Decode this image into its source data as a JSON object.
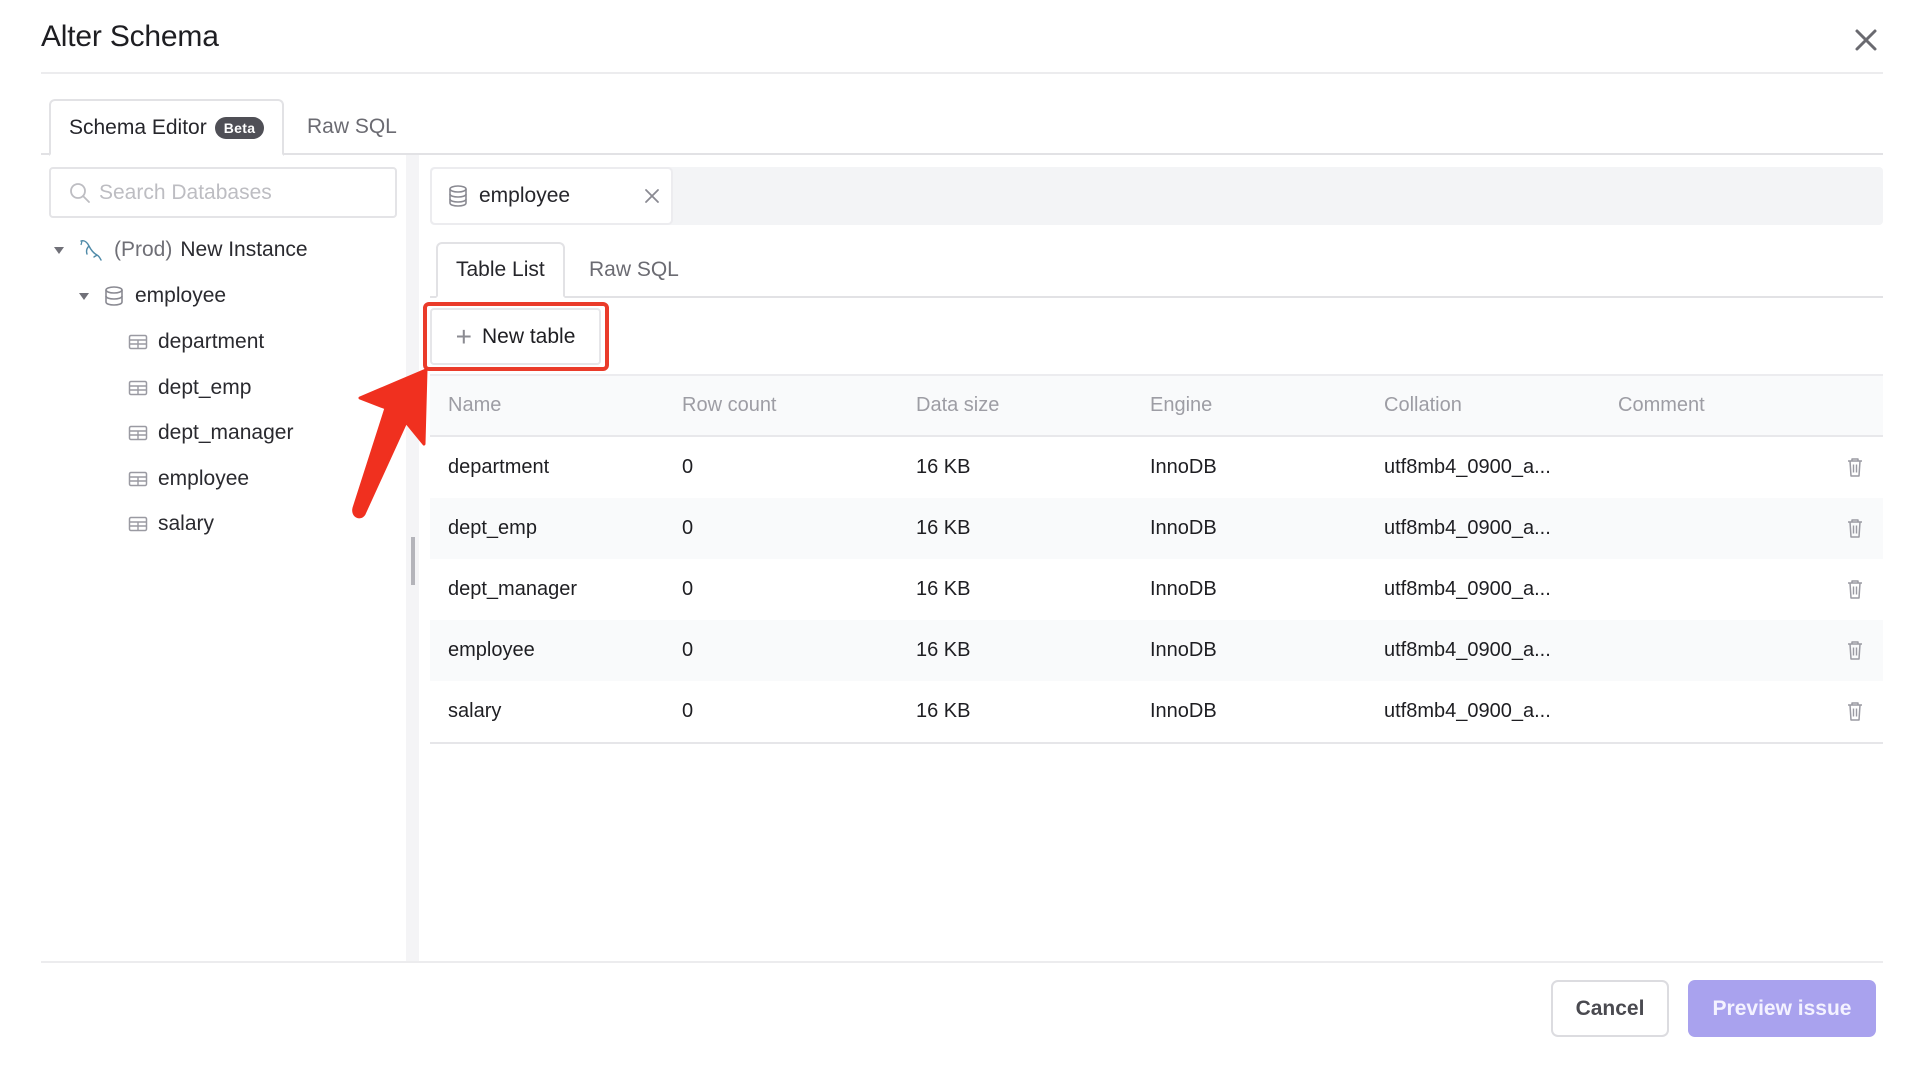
{
  "dialog": {
    "title": "Alter Schema",
    "close_icon": "close-icon"
  },
  "top_tabs": [
    {
      "label": "Schema Editor",
      "badge": "Beta",
      "active": true
    },
    {
      "label": "Raw SQL",
      "active": false
    }
  ],
  "sidebar": {
    "search_placeholder": "Search Databases",
    "search_value": "",
    "instance": {
      "env": "(Prod)",
      "name": "New Instance",
      "icon": "mysql-dolphin-icon",
      "expanded": true
    },
    "database": {
      "name": "employee",
      "icon": "database-icon",
      "expanded": true
    },
    "tables": [
      "department",
      "dept_emp",
      "dept_manager",
      "employee",
      "salary"
    ]
  },
  "main": {
    "open_database_chip": "employee",
    "inner_tabs": [
      {
        "label": "Table List",
        "active": true
      },
      {
        "label": "Raw SQL",
        "active": false
      }
    ],
    "new_table_label": "New table",
    "table": {
      "columns": [
        "Name",
        "Row count",
        "Data size",
        "Engine",
        "Collation",
        "Comment"
      ],
      "rows": [
        {
          "name": "department",
          "row_count": "0",
          "data_size": "16 KB",
          "engine": "InnoDB",
          "collation": "utf8mb4_0900_a...",
          "comment": ""
        },
        {
          "name": "dept_emp",
          "row_count": "0",
          "data_size": "16 KB",
          "engine": "InnoDB",
          "collation": "utf8mb4_0900_a...",
          "comment": ""
        },
        {
          "name": "dept_manager",
          "row_count": "0",
          "data_size": "16 KB",
          "engine": "InnoDB",
          "collation": "utf8mb4_0900_a...",
          "comment": ""
        },
        {
          "name": "employee",
          "row_count": "0",
          "data_size": "16 KB",
          "engine": "InnoDB",
          "collation": "utf8mb4_0900_a...",
          "comment": ""
        },
        {
          "name": "salary",
          "row_count": "0",
          "data_size": "16 KB",
          "engine": "InnoDB",
          "collation": "utf8mb4_0900_a...",
          "comment": ""
        }
      ]
    }
  },
  "footer": {
    "cancel_label": "Cancel",
    "preview_label": "Preview issue"
  },
  "annotation": {
    "highlight_color": "#ea3b2a",
    "target": "New table"
  },
  "colors": {
    "primary_disabled": "#a9a2ee",
    "badge_bg": "#4f4f56"
  }
}
